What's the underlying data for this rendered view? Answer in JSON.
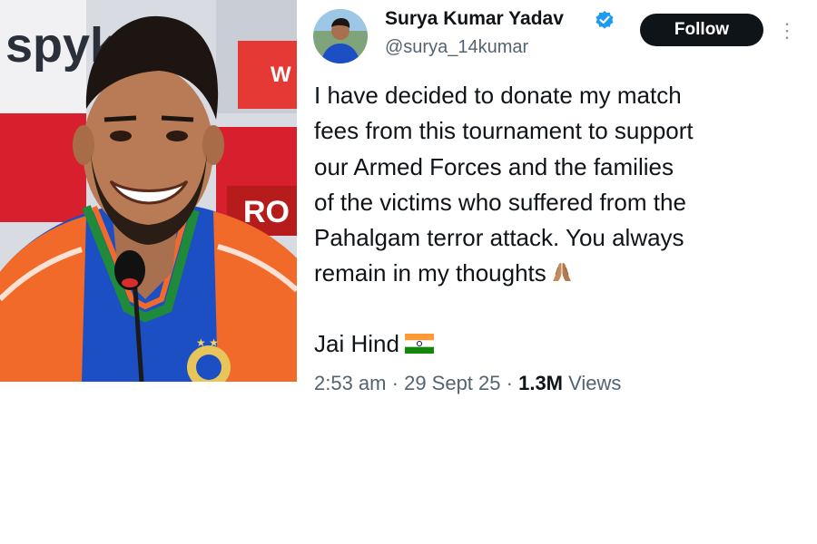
{
  "photo": {
    "background_sign_texts": [
      "spyk",
      "W",
      "RO"
    ]
  },
  "tweet": {
    "author_name": "Surya Kumar Yadav",
    "handle": "@surya_14kumar",
    "follow_label": "Follow",
    "more_icon": "⋮",
    "text_lines": [
      "I have decided to donate my match",
      "fees from this tournament to support",
      "our Armed Forces and the families",
      "of the victims who suffered from the",
      "Pahalgam terror attack. You always",
      "remain in my thoughts"
    ],
    "closing": "Jai Hind",
    "time": "2:53 am",
    "separator": "·",
    "date": "29 Sept 25",
    "views_count": "1.3M",
    "views_label": "Views"
  },
  "colors": {
    "follow_bg": "#0f1419",
    "verified": "#1d9bf0",
    "secondary_text": "#536471",
    "jersey_blue": "#1d4fc4",
    "jersey_orange": "#f26a2a"
  },
  "icons": [
    "verified-badge-icon",
    "folded-hands-icon",
    "india-flag-icon",
    "more-options-icon"
  ]
}
